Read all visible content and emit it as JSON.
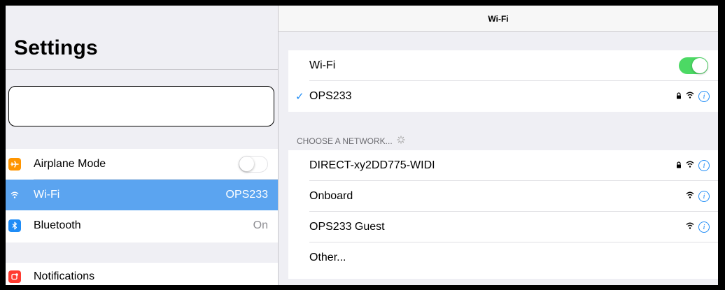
{
  "left": {
    "title": "Settings",
    "search": {
      "value": ""
    },
    "items": [
      {
        "label": "Airplane Mode",
        "icon": "airplane-icon",
        "toggle": "off"
      },
      {
        "label": "Wi-Fi",
        "icon": "wifi-icon",
        "value": "OPS233",
        "selected": true
      },
      {
        "label": "Bluetooth",
        "icon": "bluetooth-icon",
        "value": "On"
      },
      {
        "label": "Notifications",
        "icon": "notifications-icon"
      }
    ]
  },
  "right": {
    "nav_title": "Wi-Fi",
    "wifi_row": {
      "label": "Wi-Fi",
      "toggle": "on"
    },
    "connected_network": {
      "name": "OPS233",
      "secured": true
    },
    "section_header": "CHOOSE A NETWORK...",
    "networks": [
      {
        "name": "DIRECT-xy2DD775-WIDI",
        "secured": true
      },
      {
        "name": "Onboard",
        "secured": false
      },
      {
        "name": "OPS233 Guest",
        "secured": false
      }
    ],
    "other_label": "Other..."
  },
  "colors": {
    "accent": "#1f8cf6",
    "selected_row": "#5ba4f0",
    "toggle_on": "#4cd964",
    "airplane_icon": "#ff9500",
    "notifications_icon": "#ff3b30"
  }
}
